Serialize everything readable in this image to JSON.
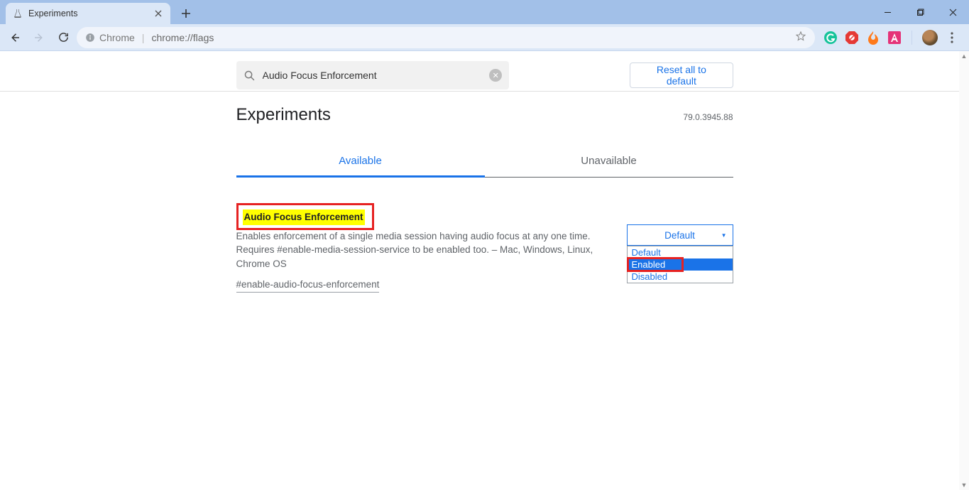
{
  "window": {
    "tab_title": "Experiments"
  },
  "toolbar": {
    "secure_label": "Chrome",
    "url": "chrome://flags"
  },
  "search": {
    "value": "Audio Focus Enforcement"
  },
  "reset_label": "Reset all to default",
  "page_title": "Experiments",
  "version": "79.0.3945.88",
  "tabs": {
    "available": "Available",
    "unavailable": "Unavailable"
  },
  "flag": {
    "title": "Audio Focus Enforcement",
    "desc": "Enables enforcement of a single media session having audio focus at any one time. Requires #enable-media-session-service to be enabled too. – Mac, Windows, Linux, Chrome OS",
    "anchor": "#enable-audio-focus-enforcement",
    "select_value": "Default",
    "options": {
      "default": "Default",
      "enabled": "Enabled",
      "disabled": "Disabled"
    }
  }
}
